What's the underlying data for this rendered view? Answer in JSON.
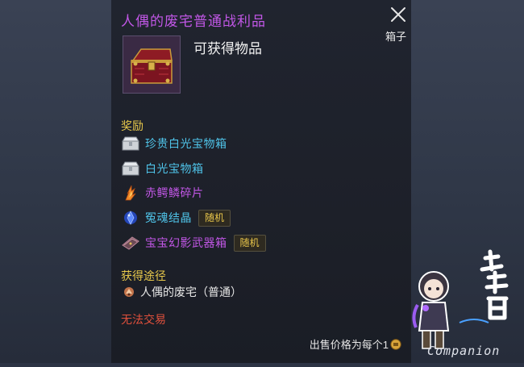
{
  "tooltip": {
    "title": "人偶的废宅普通战利品",
    "item_type": "箱子",
    "obtainable_label": "可获得物品",
    "close_icon": "close-icon",
    "item_icon": "red-treasure-chest-icon"
  },
  "rewards": {
    "heading": "奖励",
    "items": [
      {
        "name": "珍贵白光宝物箱",
        "icon": "silver-chest-icon",
        "color": "#4fc3e8",
        "badge": ""
      },
      {
        "name": "白光宝物箱",
        "icon": "silver-chest-icon",
        "color": "#4fc3e8",
        "badge": ""
      },
      {
        "name": "赤鳄鳞碎片",
        "icon": "flame-shard-icon",
        "color": "#c157e6",
        "badge": ""
      },
      {
        "name": "冤魂结晶",
        "icon": "blue-crystal-icon",
        "color": "#4fc3e8",
        "badge": "随机"
      },
      {
        "name": "宝宝幻影武器箱",
        "icon": "weapon-box-icon",
        "color": "#c157e6",
        "badge": "随机"
      }
    ]
  },
  "source": {
    "heading": "获得途径",
    "location": "人偶的废宅（普通）",
    "icon": "dungeon-icon"
  },
  "trade": {
    "status": "无法交易"
  },
  "sell": {
    "label": "出售价格为每个1",
    "icon": "coin-icon"
  },
  "watermark": {
    "logo_text": "攻略组",
    "subtitle": "Companion"
  },
  "colors": {
    "title": "#c157e6",
    "section_heading": "#e7c84b",
    "untradable": "#e0503c",
    "badge_text": "#e9c64a"
  }
}
